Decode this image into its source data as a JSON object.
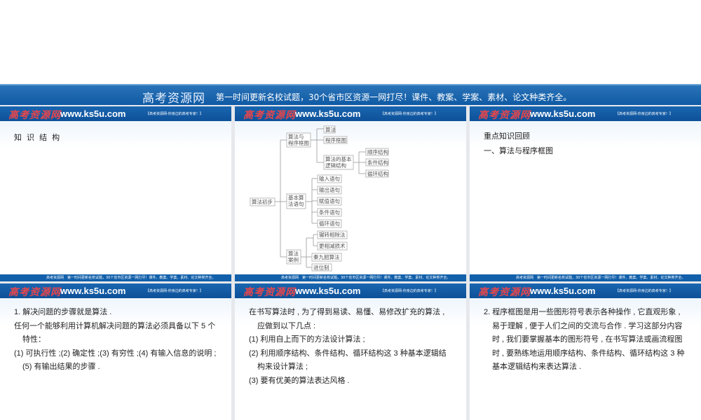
{
  "banner": {
    "site": "高考资源网",
    "slogan": "第一时间更新名校试题，30个省市区资源一网打尽！课件、教案、学案、素材、论文种类齐全。"
  },
  "slide_header": {
    "logo": "高考资源网",
    "url": "www.ks5u.com",
    "tagline": "【高考资源网-你身边的高考专家！】"
  },
  "slide_footer": "高考资源网　第一时间更新名校试题，30个省市区资源一网打尽！课件、教案、学案、素材、论文种类齐全。",
  "colors": {
    "header_blue": "#0d5199",
    "logo_red": "#e8464b"
  },
  "slide1": {
    "title": "知 识 结 构"
  },
  "diagram": {
    "root": [
      "算法初步"
    ],
    "g1": [
      "算法与",
      "程序框图"
    ],
    "g1a": [
      "算法"
    ],
    "g1b": [
      "程序框图"
    ],
    "g1c": [
      "算法的基本",
      "逻辑结构"
    ],
    "s1": [
      "顺序结构"
    ],
    "s2": [
      "条件结构"
    ],
    "s3": [
      "循环结构"
    ],
    "g2": [
      "基本算",
      "法语句"
    ],
    "g2a": [
      "输入语句"
    ],
    "g2b": [
      "输出语句"
    ],
    "g2c": [
      "赋值语句"
    ],
    "g2d": [
      "条件语句"
    ],
    "g2e": [
      "循环语句"
    ],
    "g3": [
      "算法",
      "案例"
    ],
    "g3a": [
      "辗转相除法"
    ],
    "g3b": [
      "更相减损术"
    ],
    "g3c": [
      "秦九韶算法"
    ],
    "g3d": [
      "进位制"
    ]
  },
  "slide3": {
    "line1": "重点知识回顾",
    "line2": "一、算法与程序框图"
  },
  "slide4": [
    "1. 解决问题的步骤就是算法 .",
    "任何一个能够利用计算机解决问题的算法必须具备以下 5 个特性：",
    "(1) 可执行性 ;(2) 确定性 ;(3) 有穷性 ;(4) 有输入信息的说明 ;(5) 有输出结果的步骤 ."
  ],
  "slide5": [
    "在书写算法时 , 为了得到易读、易懂、易修改扩充的算法 , 应做到以下几点 :",
    "(1) 利用自上而下的方法设计算法 ;",
    "(2) 利用顺序结构、条件结构、循环结构这 3 种基本逻辑结构来设计算法 ;",
    "(3) 要有优美的算法表达风格 ."
  ],
  "slide6": [
    "2. 程序框图是用一些图形符号表示各种操作 , 它直观形象 , 易于理解 , 便于人们之间的交流与合作 . 学习这部分内容时 , 我们要掌握基本的图形符号 , 在书写算法或画流程图时 , 要熟练地运用顺序结构、条件结构、循环结构这 3 种基本逻辑结构来表达算法 ."
  ]
}
